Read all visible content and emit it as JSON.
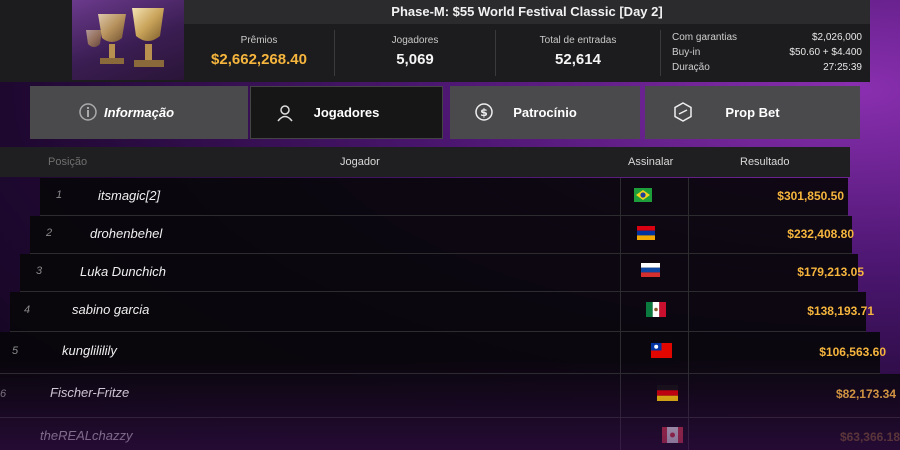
{
  "header": {
    "title": "Phase-M: $55 World Festival Classic [Day 2]",
    "prizes_label": "Prêmios",
    "prizes_value": "$2,662,268.40",
    "players_label": "Jogadores",
    "players_value": "5,069",
    "entries_label": "Total de entradas",
    "entries_value": "52,614",
    "guarantee_label": "Com garantias",
    "guarantee_value": "$2,026,000",
    "buyin_label": "Buy-in",
    "buyin_value": "$50.60 + $4.400",
    "duration_label": "Duração",
    "duration_value": "27:25:39"
  },
  "tabs": [
    {
      "label": "Informação",
      "icon": "info-icon"
    },
    {
      "label": "Jogadores",
      "icon": "user-icon"
    },
    {
      "label": "Patrocínio",
      "icon": "dollar-coin-icon"
    },
    {
      "label": "Prop Bet",
      "icon": "prop-bet-icon"
    }
  ],
  "active_tab": "Jogadores",
  "table": {
    "columns": [
      "Posição",
      "Jogador",
      "Assinalar",
      "Resultado"
    ],
    "rows": [
      {
        "pos": "1",
        "player": "itsmagic[2]",
        "flag": "brazil-flag",
        "result": "$301,850.50"
      },
      {
        "pos": "2",
        "player": "drohenbehel",
        "flag": "armenia-flag",
        "result": "$232,408.80"
      },
      {
        "pos": "3",
        "player": "Luka Dunchich",
        "flag": "slovenia-flag",
        "result": "$179,213.05"
      },
      {
        "pos": "4",
        "player": "sabino garcia",
        "flag": "mexico-flag",
        "result": "$138,193.71"
      },
      {
        "pos": "5",
        "player": "kunglililily",
        "flag": "taiwan-flag",
        "result": "$106,563.60"
      },
      {
        "pos": "6",
        "player": "Fischer-Fritze",
        "flag": "germany-flag",
        "result": "$82,173.34"
      },
      {
        "pos": "",
        "player": "theREALchazzy",
        "flag": "canada-flag",
        "result": "$63,366.18"
      }
    ]
  },
  "colors": {
    "gold": "#f6b53d",
    "tab_bg": "#4a4a4d",
    "tab_active_bg": "#161616",
    "header_bg": "#1c1c1e"
  }
}
